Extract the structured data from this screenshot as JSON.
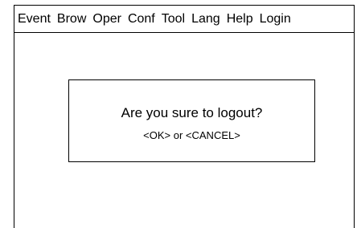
{
  "menubar": {
    "items": [
      {
        "label": "Event"
      },
      {
        "label": "Brow"
      },
      {
        "label": "Oper"
      },
      {
        "label": "Conf"
      },
      {
        "label": "Tool"
      },
      {
        "label": "Lang"
      },
      {
        "label": "Help"
      },
      {
        "label": "Login"
      }
    ]
  },
  "dialog": {
    "message": "Are you sure to logout?",
    "options": "<OK> or <CANCEL>"
  }
}
